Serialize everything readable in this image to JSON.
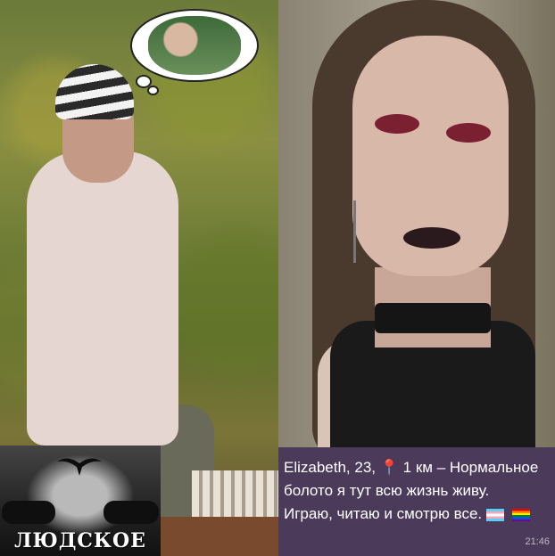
{
  "logo": {
    "text": "ЛЮДСКОЕ"
  },
  "profile": {
    "name_age": "Elizabeth, 23,",
    "distance": "1 км",
    "line1_rest": "– Нормальное",
    "line2": "болото я тут всю жизнь живу.",
    "line3": "Играю, читаю и смотрю все.",
    "time": "21:46",
    "pin_icon": "location-pin-icon",
    "flags": [
      "transgender-flag-icon",
      "rainbow-flag-icon"
    ]
  }
}
